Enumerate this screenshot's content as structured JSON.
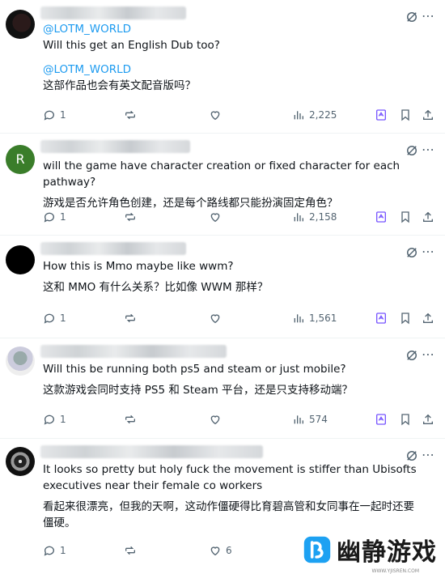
{
  "posts": [
    {
      "avatar_letter": "",
      "lines": [
        {
          "kind": "mention",
          "text": "@LOTM_WORLD"
        },
        {
          "kind": "text",
          "text": "Will this get an English Dub too?"
        },
        {
          "kind": "gap",
          "text": ""
        },
        {
          "kind": "mention",
          "text": "@LOTM_WORLD"
        },
        {
          "kind": "text",
          "text": "这部作品也会有英文配音版吗？"
        }
      ],
      "replies": "1",
      "reposts": "",
      "likes": "",
      "views": "2,225"
    },
    {
      "avatar_letter": "R",
      "lines": [
        {
          "kind": "text",
          "text": "will the game have character creation or fixed character for each pathway?"
        },
        {
          "kind": "gap",
          "text": ""
        },
        {
          "kind": "text",
          "text": "游戏是否允许角色创建，还是每个路线都只能扮演固定角色？"
        }
      ],
      "replies": "1",
      "reposts": "",
      "likes": "",
      "views": "2,158"
    },
    {
      "avatar_letter": "",
      "lines": [
        {
          "kind": "text",
          "text": "How this is Mmo maybe like wwm?"
        },
        {
          "kind": "gap",
          "text": ""
        },
        {
          "kind": "text",
          "text": "这和 MMO 有什么关系？比如像 WWM 那样？"
        }
      ],
      "replies": "1",
      "reposts": "",
      "likes": "",
      "views": "1,561"
    },
    {
      "avatar_letter": "",
      "lines": [
        {
          "kind": "text",
          "text": "Will this be running both ps5 and steam or just mobile?"
        },
        {
          "kind": "gap",
          "text": ""
        },
        {
          "kind": "text",
          "text": "这款游戏会同时支持 PS5 和 Steam 平台，还是只支持移动端？"
        }
      ],
      "replies": "1",
      "reposts": "",
      "likes": "",
      "views": "574"
    },
    {
      "avatar_letter": "",
      "lines": [
        {
          "kind": "text",
          "text": "It looks so pretty but holy fuck the movement is stiffer than Ubisofts"
        },
        {
          "kind": "text",
          "text": "executives near their female co workers"
        },
        {
          "kind": "gap",
          "text": ""
        },
        {
          "kind": "text",
          "text": "看起来很漂亮，但我的天啊，这动作僵硬得比育碧高管和女同事在一起时还要"
        },
        {
          "kind": "text",
          "text": "僵硬。"
        }
      ],
      "replies": "1",
      "reposts": "",
      "likes": "6",
      "views": ""
    }
  ],
  "watermark": {
    "text": "幽静游戏",
    "url": "WWW.YJISREN.COM"
  }
}
